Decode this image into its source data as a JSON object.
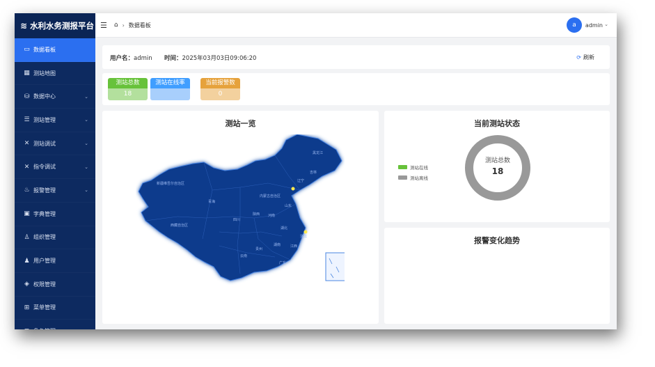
{
  "app": {
    "title": "水利水务测报平台"
  },
  "sidebar": {
    "items": [
      {
        "label": "数据看板",
        "icon": "dashboard-icon",
        "active": true,
        "submenu": false
      },
      {
        "label": "测站地图",
        "icon": "map-icon",
        "submenu": false
      },
      {
        "label": "数据中心",
        "icon": "database-icon",
        "submenu": true
      },
      {
        "label": "测站管理",
        "icon": "list-icon",
        "submenu": true
      },
      {
        "label": "测站调试",
        "icon": "tools-icon",
        "submenu": true
      },
      {
        "label": "指令调试",
        "icon": "tools-icon",
        "submenu": true
      },
      {
        "label": "报警管理",
        "icon": "alarm-icon",
        "submenu": true
      },
      {
        "label": "字典管理",
        "icon": "dictionary-icon",
        "submenu": false
      },
      {
        "label": "组织管理",
        "icon": "org-icon",
        "submenu": false
      },
      {
        "label": "用户管理",
        "icon": "user-icon",
        "submenu": false
      },
      {
        "label": "权限管理",
        "icon": "shield-icon",
        "submenu": false
      },
      {
        "label": "菜单管理",
        "icon": "grid-icon",
        "submenu": false
      },
      {
        "label": "角色管理",
        "icon": "grid-icon",
        "submenu": false
      }
    ]
  },
  "topbar": {
    "breadcrumb": "数据看板",
    "avatar_letter": "a",
    "username": "admin"
  },
  "info": {
    "user_label": "用户名：",
    "user_value": "admin",
    "time_label": "时间：",
    "time_value": "2025年03月03日09:06:20",
    "refresh_label": "刷新"
  },
  "stats": [
    {
      "label": "测站总数",
      "value": "18",
      "color": "#67c23a"
    },
    {
      "label": "测站在线率",
      "value": "",
      "color": "#409eff"
    },
    {
      "label": "当前报警数",
      "value": "0",
      "color": "#e6a23c"
    }
  ],
  "map_panel": {
    "title": "测站一览"
  },
  "status_panel": {
    "title": "当前测站状态",
    "legend": [
      {
        "label": "测站在线",
        "color": "#67c23a"
      },
      {
        "label": "测站离线",
        "color": "#999999"
      }
    ],
    "center_label": "测站总数",
    "center_value": "18"
  },
  "trend_panel": {
    "title": "报警变化趋势"
  },
  "colors": {
    "sidebar": "#0d2a60",
    "accent": "#2b6ff0",
    "map_fill": "#0f3a8c"
  }
}
